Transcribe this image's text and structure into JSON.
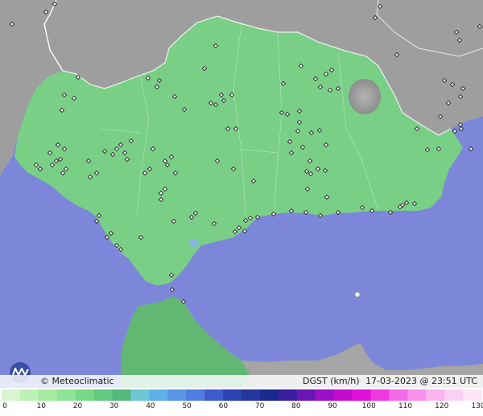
{
  "map": {
    "credit": "© Meteoclimatic",
    "variable": "DGST (km/h)",
    "datetime": "17-03-2023 @ 23:51 UTC",
    "colors": {
      "sea": "#7d87da",
      "land_foreign": "#9e9e9e",
      "land_region": "#79cf86",
      "land_africa": "#62b873",
      "mountain": "#a3a3a3",
      "station": "#222222"
    }
  },
  "legend": {
    "ticks": [
      "0",
      "10",
      "20",
      "30",
      "40",
      "50",
      "60",
      "70",
      "80",
      "90",
      "100",
      "110",
      "120",
      "130"
    ],
    "colors": [
      "#d8f5d0",
      "#bdf0b4",
      "#a3eba0",
      "#8ee497",
      "#78d889",
      "#62c97e",
      "#54b97a",
      "#6cc8d6",
      "#5fb0e8",
      "#5a95e8",
      "#4f7ee0",
      "#3e5ccc",
      "#2d44b4",
      "#2436a0",
      "#1a2a8c",
      "#3a1ea0",
      "#6a16b4",
      "#9c10c8",
      "#c40ccc",
      "#e010d8",
      "#f038e0",
      "#f46ae6",
      "#f890ec",
      "#fab4f0",
      "#fcd0f4",
      "#fee4f8"
    ]
  }
}
